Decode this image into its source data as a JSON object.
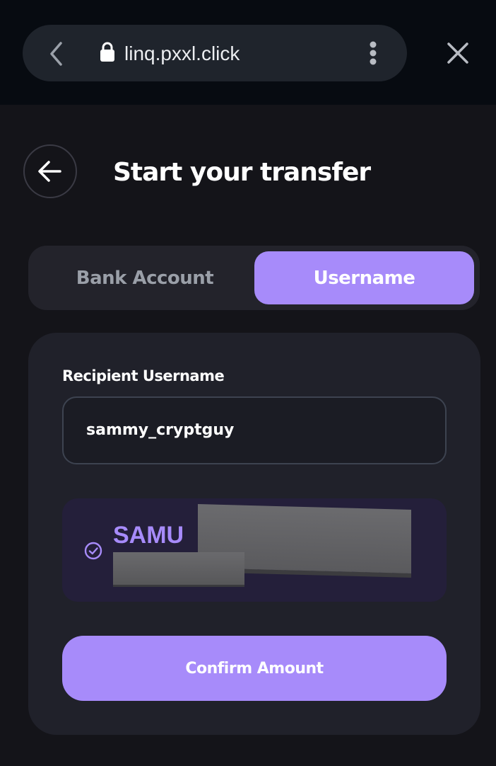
{
  "browser": {
    "url": "linq.pxxl.click"
  },
  "header": {
    "title": "Start your transfer"
  },
  "tabs": [
    {
      "label": "Bank Account",
      "selected": false
    },
    {
      "label": "Username",
      "selected": true
    }
  ],
  "form": {
    "label": "Recipient Username",
    "value": "sammy_cryptguy"
  },
  "recipient": {
    "name_visible": "SAMU",
    "verified": true,
    "icon": "check-circle-icon"
  },
  "actions": {
    "confirm_label": "Confirm Amount"
  },
  "colors": {
    "accent": "#a78bfa",
    "background": "#141419",
    "card": "#20212a"
  }
}
